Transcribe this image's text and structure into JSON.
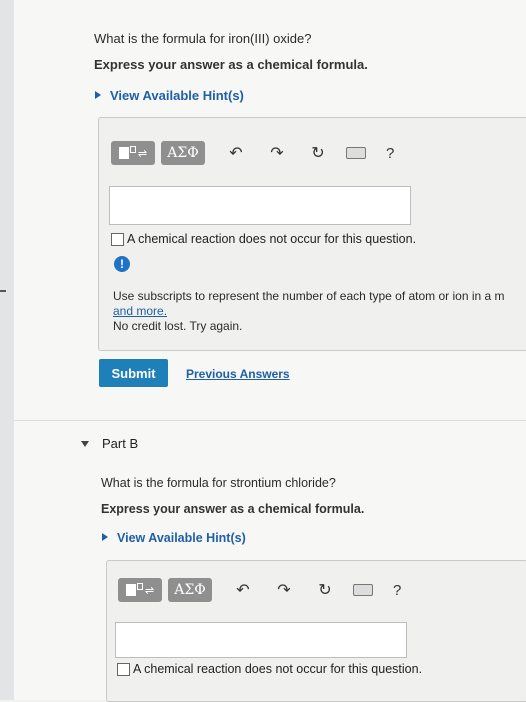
{
  "partA": {
    "question": "What is the formula for iron(III) oxide?",
    "instruction": "Express your answer as a chemical formula.",
    "hint_link": "View Available Hint(s)",
    "toolbar": {
      "symbols_label": "ΑΣΦ",
      "help_label": "?"
    },
    "answer_value": "",
    "no_reaction_label": "A chemical reaction does not occur for this question.",
    "feedback": {
      "icon_label": "!",
      "line1": "Use subscripts to represent the number of each type of atom or ion in a m",
      "link": "and more.",
      "line2": "No credit lost. Try again."
    },
    "submit_label": "Submit",
    "previous_answers_label": "Previous Answers"
  },
  "partB": {
    "title": "Part B",
    "question": "What is the formula for strontium chloride?",
    "instruction": "Express your answer as a chemical formula.",
    "hint_link": "View Available Hint(s)",
    "toolbar": {
      "symbols_label": "ΑΣΦ",
      "help_label": "?"
    },
    "answer_value": "",
    "no_reaction_label": "A chemical reaction does not occur for this question."
  }
}
